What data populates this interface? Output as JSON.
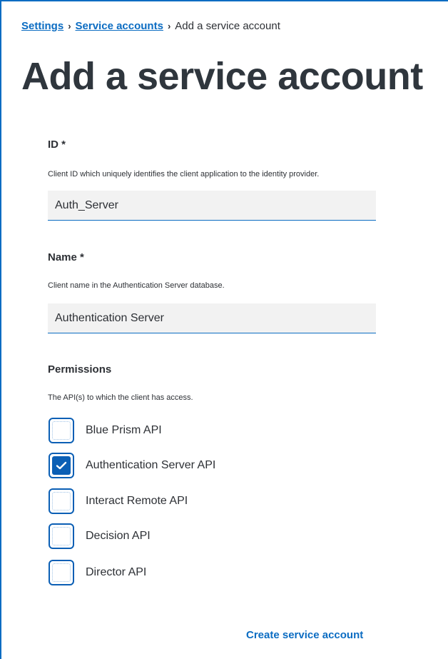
{
  "breadcrumb": {
    "settings": "Settings",
    "service_accounts": "Service accounts",
    "current": "Add a service account",
    "separator": "›"
  },
  "page": {
    "title": "Add a service account"
  },
  "form": {
    "id": {
      "label": "ID *",
      "help": "Client ID which uniquely identifies the client application to the identity provider.",
      "value": "Auth_Server"
    },
    "name": {
      "label": "Name *",
      "help": "Client name in the Authentication Server database.",
      "value": "Authentication Server"
    },
    "permissions": {
      "label": "Permissions",
      "help": "The API(s) to which the client has access.",
      "items": [
        {
          "label": "Blue Prism API",
          "checked": false
        },
        {
          "label": "Authentication Server API",
          "checked": true
        },
        {
          "label": "Interact Remote API",
          "checked": false
        },
        {
          "label": "Decision API",
          "checked": false
        },
        {
          "label": "Director API",
          "checked": false
        }
      ]
    }
  },
  "actions": {
    "create_label": "Create service account"
  },
  "colors": {
    "accent": "#0b6cc2",
    "checkbox_border": "#0b5fb5",
    "input_background": "#f2f2f2",
    "title_text": "#2f363d"
  },
  "icons": {
    "breadcrumb_separator": "chevron-right-icon",
    "checkmark": "checkmark-icon"
  }
}
